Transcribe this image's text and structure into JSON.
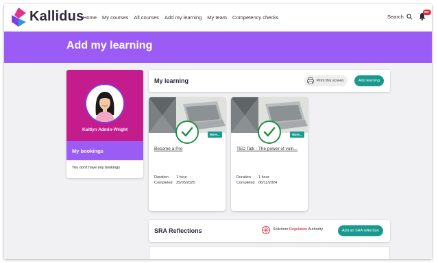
{
  "brand": {
    "name": "Kallidus",
    "logo_icon": "kallidus-logo-icon"
  },
  "nav": {
    "items": [
      "Home",
      "My courses",
      "All courses",
      "Add my learning",
      "My team",
      "Competency checks"
    ],
    "search_label": "Search",
    "notification_badge": "99+"
  },
  "banner": {
    "title": "Add my learning"
  },
  "profile": {
    "name": "Kaitlyn Admin-Wright",
    "bookings_label": "My bookings",
    "no_bookings": "You don't have any bookings"
  },
  "my_learning": {
    "title": "My learning",
    "print_label": "Print this screen",
    "add_label": "Add learning",
    "cards": [
      {
        "title": "Become a Pro",
        "duration_label": "Duration",
        "duration": "1 hour",
        "completed_label": "Completed",
        "completed": "25/05/2025",
        "more_label": "More..."
      },
      {
        "title": "TED Talk - The power of vuln...",
        "duration_label": "Duration",
        "duration": "1 hour",
        "completed_label": "Completed",
        "completed": "06/11/2024",
        "more_label": "More..."
      }
    ]
  },
  "sra": {
    "title": "SRA Reflections",
    "logo_word_1": "Solicitors",
    "logo_word_2": "Regulation",
    "logo_word_3": "Authority",
    "add_label": "Add an SRA reflection"
  },
  "colors": {
    "accent_purple": "#9b5cf6",
    "profile_magenta": "#c51c8d",
    "teal_button": "#1a9a8f",
    "check_green": "#1f8f46",
    "badge_red": "#e0243a"
  }
}
